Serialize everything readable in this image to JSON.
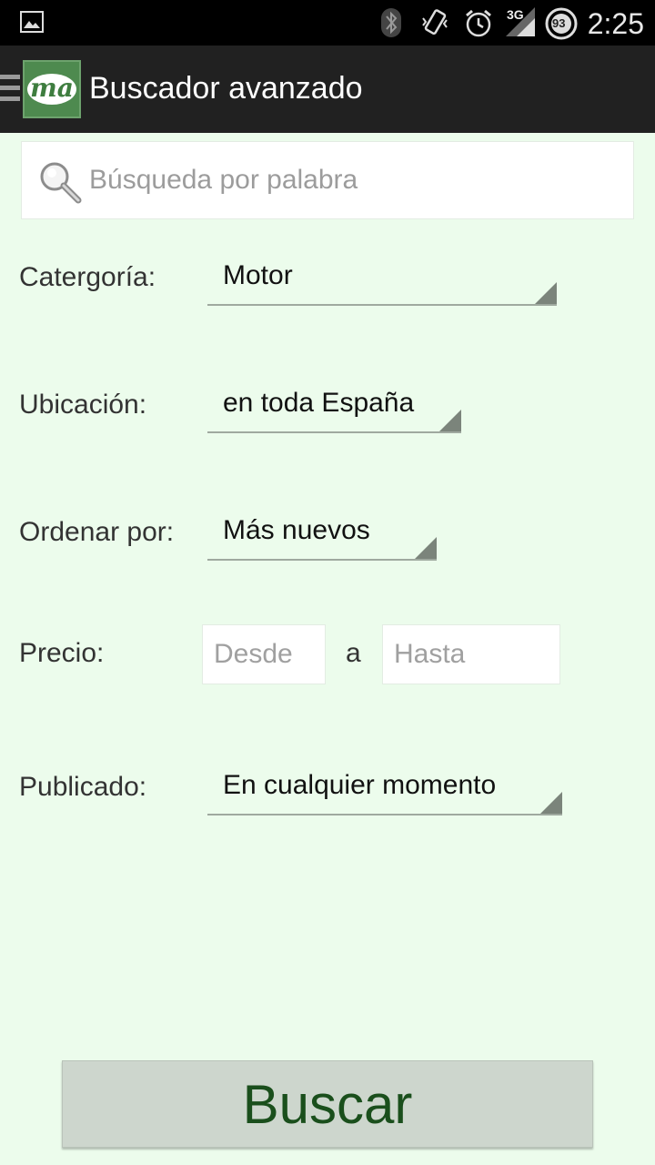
{
  "status_bar": {
    "time": "2:25",
    "network_label": "3G",
    "battery_level": "93",
    "icons": [
      "image-icon",
      "bluetooth-icon",
      "vibrate-icon",
      "alarm-icon",
      "signal-3g-icon",
      "battery-icon"
    ]
  },
  "action_bar": {
    "logo_text": "ma",
    "title": "Buscador avanzado"
  },
  "search": {
    "placeholder": "Búsqueda por palabra"
  },
  "form": {
    "category": {
      "label": "Catergoría:",
      "value": "Motor"
    },
    "location": {
      "label": "Ubicación:",
      "value": "en toda España"
    },
    "order": {
      "label": "Ordenar por:",
      "value": "Más nuevos"
    },
    "price": {
      "label": "Precio:",
      "from_placeholder": "Desde",
      "separator": "a",
      "to_placeholder": "Hasta"
    },
    "published": {
      "label": "Publicado:",
      "value": "En cualquier momento"
    }
  },
  "submit": {
    "label": "Buscar"
  },
  "colors": {
    "background": "#ecfcec",
    "action_bar": "#212121",
    "logo_green": "#4e8a4f",
    "button_text": "#1a4f1c"
  }
}
